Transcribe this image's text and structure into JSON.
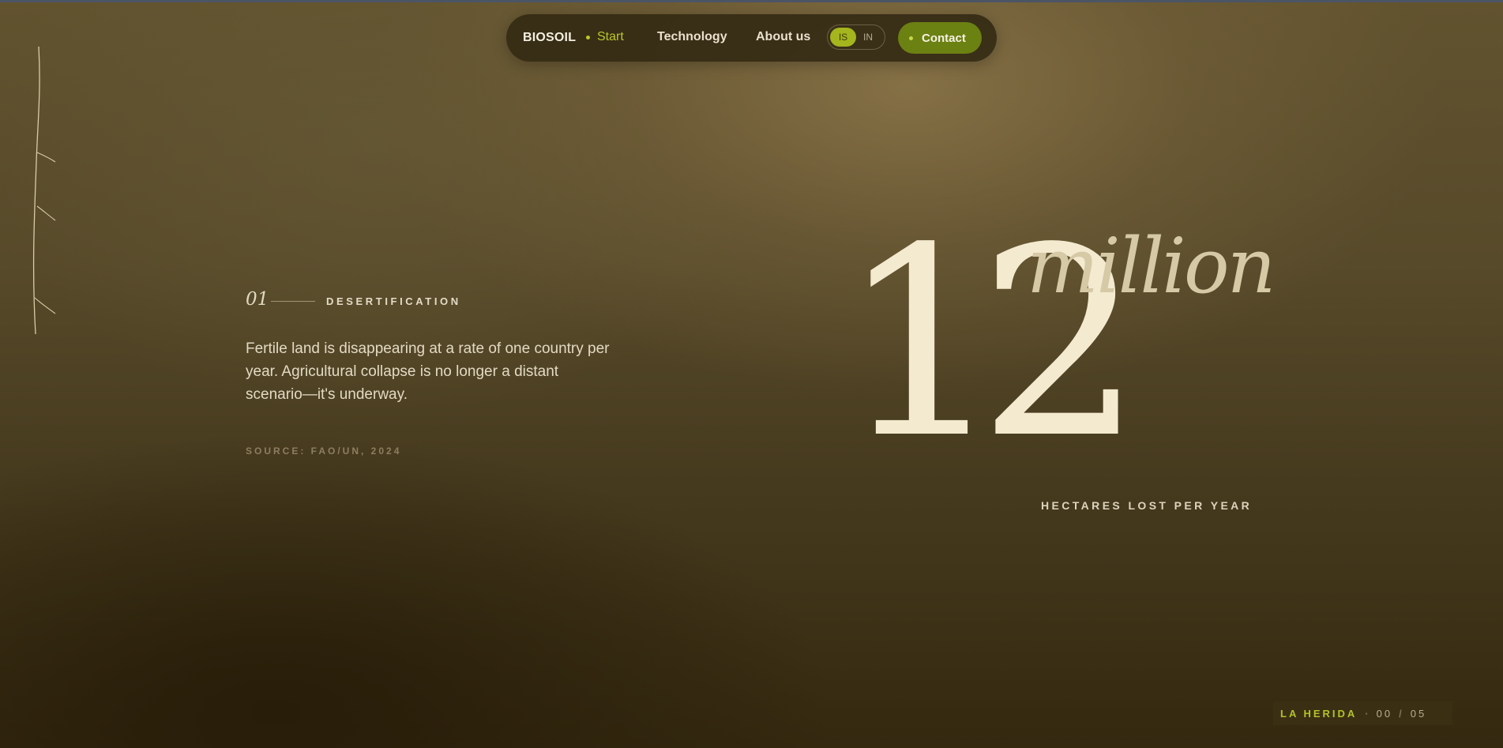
{
  "nav": {
    "logo": "BIOSOIL",
    "start_label": "Start",
    "technology_label": "Technology",
    "about_label": "About us",
    "lang_active": "IS",
    "lang_inactive": "IN",
    "contact_label": "Contact"
  },
  "section": {
    "number": "01",
    "title": "DESERTIFICATION",
    "body": "Fertile land is disappearing at a rate of one country per year. Agricultural collapse is no longer a distant scenario—it's underway.",
    "source": "SOURCE: FAO/UN, 2024"
  },
  "stat": {
    "value": "12",
    "unit": "million",
    "label": "HECTARES LOST PER YEAR"
  },
  "progress": {
    "chapter": "LA HERIDA",
    "current": "00",
    "separator": "/",
    "total": "05"
  },
  "colors": {
    "accent": "#b9c82a",
    "contact_bg": "#6b8112",
    "cream": "#f3ead0"
  }
}
